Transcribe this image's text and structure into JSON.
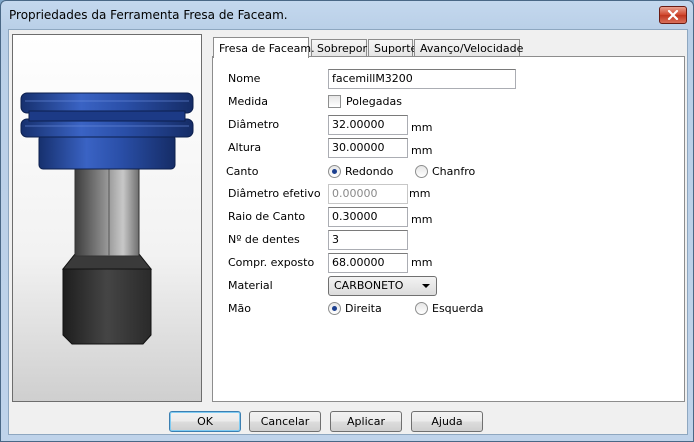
{
  "window": {
    "title": "Propriedades da Ferramenta Fresa de Faceam."
  },
  "tabs": [
    {
      "label": "Fresa de Faceam.",
      "active": true
    },
    {
      "label": "Sobrepor",
      "active": false
    },
    {
      "label": "Suporte",
      "active": false
    },
    {
      "label": "Avanço/Velocidade",
      "active": false
    }
  ],
  "form": {
    "name": {
      "label": "Nome",
      "value": "facemillM3200"
    },
    "measure": {
      "label": "Medida",
      "checkbox_label": "Polegadas",
      "checked": false
    },
    "diameter": {
      "label": "Diâmetro",
      "value": "32.00000",
      "unit": "mm"
    },
    "height": {
      "label": "Altura",
      "value": "30.00000",
      "unit": "mm"
    },
    "corner": {
      "label": "Canto",
      "option1": "Redondo",
      "option2": "Chanfro",
      "selected": "Redondo"
    },
    "effective_diameter": {
      "label": "Diâmetro efetivo",
      "value": "0.00000",
      "unit": "mm",
      "disabled": true
    },
    "corner_radius": {
      "label": "Raio de Canto",
      "value": "0.30000",
      "unit": "mm"
    },
    "teeth": {
      "label": "Nº de dentes",
      "value": "3"
    },
    "exposed_length": {
      "label": "Compr. exposto",
      "value": "68.00000",
      "unit": "mm"
    },
    "material": {
      "label": "Material",
      "value": "CARBONETO"
    },
    "hand": {
      "label": "Mão",
      "option1": "Direita",
      "option2": "Esquerda",
      "selected": "Direita"
    }
  },
  "buttons": {
    "ok": "OK",
    "cancel": "Cancelar",
    "apply": "Aplicar",
    "help": "Ajuda"
  },
  "colors": {
    "cutter_blue": "#2a4fa8",
    "holder_dark": "#3a3a3a",
    "shank_gray": "#8a8a8a"
  }
}
